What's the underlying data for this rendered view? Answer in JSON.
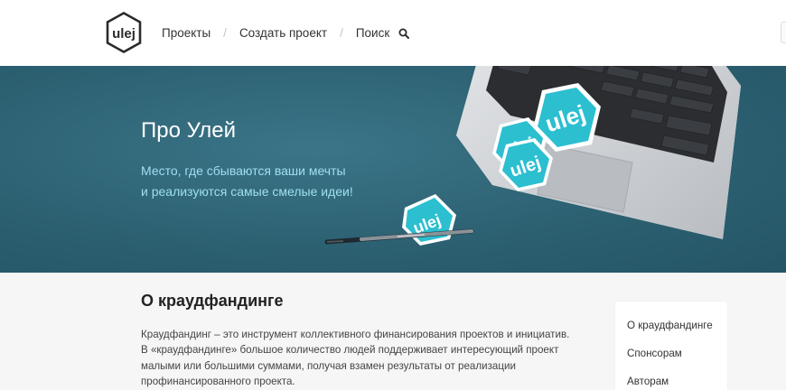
{
  "header": {
    "logo_text": "ulej",
    "nav": [
      {
        "label": "Проекты"
      },
      {
        "label": "Создать проект"
      },
      {
        "label": "Поиск"
      }
    ],
    "separator": "/"
  },
  "hero": {
    "title": "Про Улей",
    "subtitle_line1": "Место, где сбываются ваши мечты",
    "subtitle_line2": "и реализуются самые смелые идеи!",
    "sticker_text": "ulej"
  },
  "content": {
    "title": "О краудфандинге",
    "paragraph_lines": [
      "Краудфандинг – это инструмент коллективного финансирования проектов и инициатив.",
      "В «краудфандинге» большое количество людей поддерживает интересующий проект",
      "малыми или большими суммами, получая взамен результаты от реализации",
      "профинансированного проекта."
    ]
  },
  "sidebar": {
    "items": [
      {
        "label": "О краудфандинге"
      },
      {
        "label": "Спонсорам"
      },
      {
        "label": "Авторам"
      }
    ]
  },
  "colors": {
    "hero_bg": "#2f6678",
    "accent": "#9fdff0",
    "sticker": "#2bbfd0"
  }
}
